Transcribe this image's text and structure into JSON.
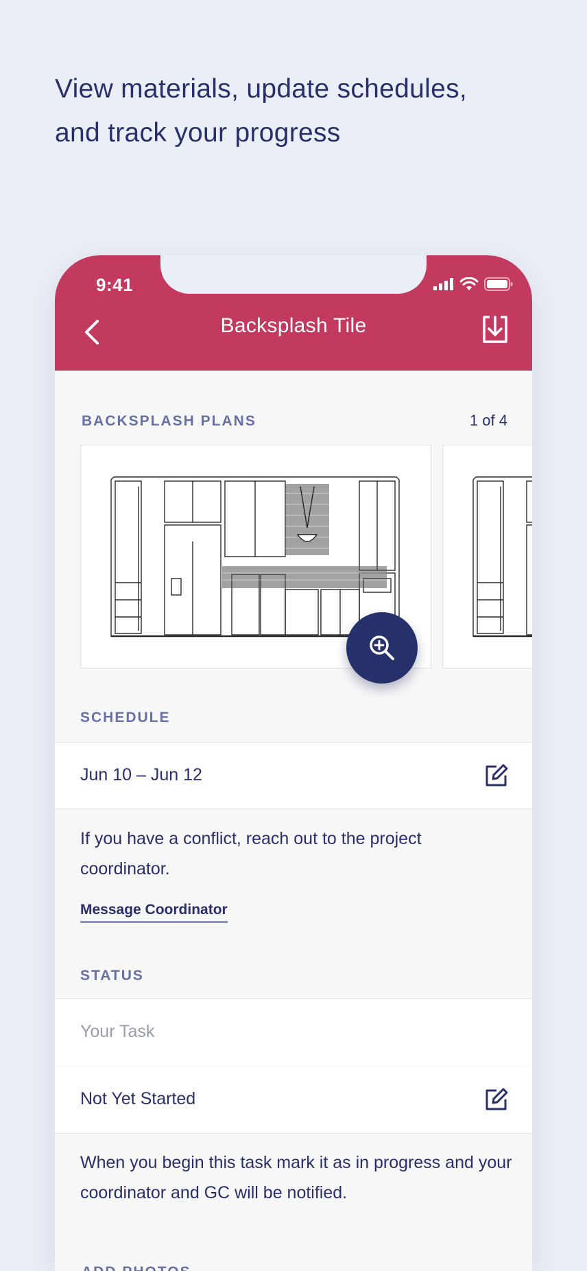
{
  "headline": {
    "line1": "View materials, update schedules,",
    "line2": "and track your progress"
  },
  "status_bar": {
    "time": "9:41"
  },
  "nav": {
    "title": "Backsplash Tile",
    "back_icon": "chevron-left-icon",
    "download_icon": "download-icon"
  },
  "plans": {
    "label": "BACKSPLASH PLANS",
    "counter": "1 of 4",
    "zoom_icon": "zoom-in-icon"
  },
  "schedule": {
    "label": "SCHEDULE",
    "dates": "Jun 10 – Jun 12",
    "note": "If you have a conflict, reach out to the project coordinator.",
    "link": "Message Coordinator"
  },
  "status": {
    "label": "STATUS",
    "placeholder": "Your Task",
    "value": "Not Yet Started",
    "note": "When you begin this task mark it as in progress and your coordinator and GC will be notified."
  },
  "photos": {
    "label": "ADD PHOTOS"
  },
  "colors": {
    "brand": "#c33a60",
    "navy": "#26306a",
    "label": "#6770a6",
    "background": "#eaeef6"
  }
}
